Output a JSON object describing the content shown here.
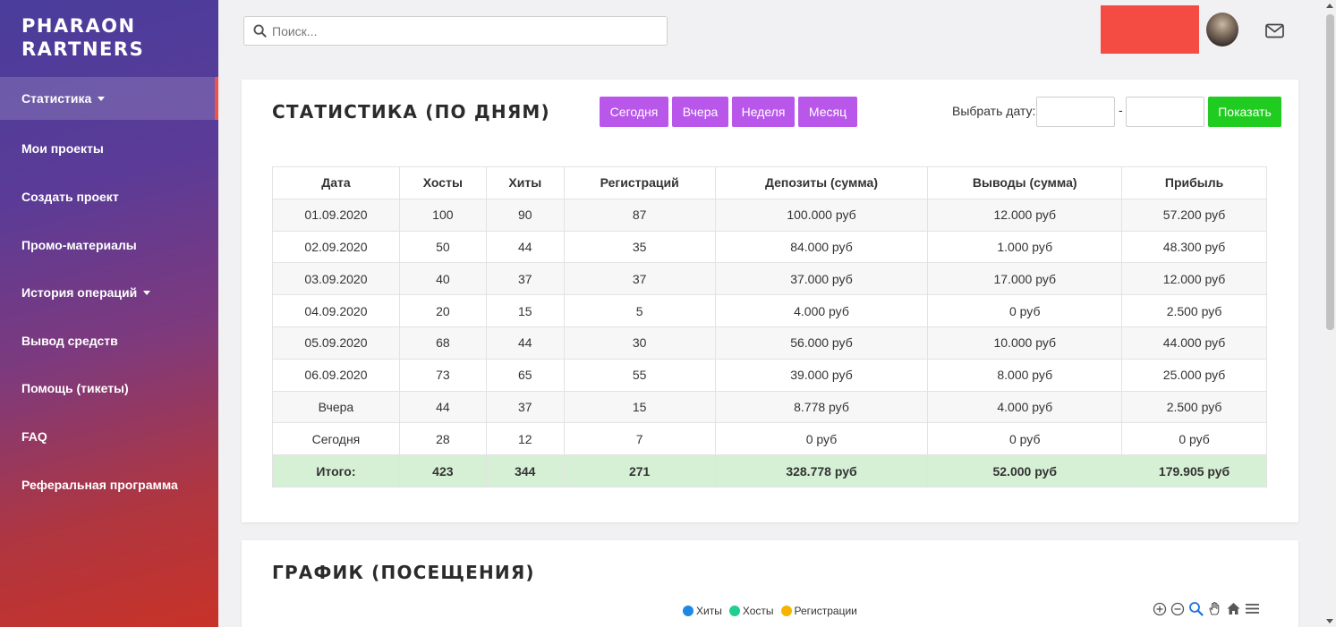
{
  "brand": {
    "line1": "PHARAON",
    "line2": "RARTNERS"
  },
  "sidebar": {
    "items": [
      {
        "label": "Статистика",
        "dropdown": true,
        "active": true
      },
      {
        "label": "Мои проекты"
      },
      {
        "label": "Создать проект"
      },
      {
        "label": "Промо-материалы"
      },
      {
        "label": "История операций",
        "dropdown": true
      },
      {
        "label": "Вывод средств"
      },
      {
        "label": "Помощь (тикеты)"
      },
      {
        "label": "FAQ"
      },
      {
        "label": "Реферальная программа"
      }
    ]
  },
  "search": {
    "placeholder": "Поиск..."
  },
  "stats": {
    "title": "СТАТИСТИКА (ПО ДНЯМ)",
    "periods": [
      "Сегодня",
      "Вчера",
      "Неделя",
      "Месяц"
    ],
    "date_label": "Выбрать дату:",
    "date_separator": "-",
    "show_label": "Показать",
    "columns": [
      "Дата",
      "Хосты",
      "Хиты",
      "Регистраций",
      "Депозиты (сумма)",
      "Выводы (сумма)",
      "Прибыль"
    ],
    "rows": [
      [
        "01.09.2020",
        "100",
        "90",
        "87",
        "100.000 руб",
        "12.000 руб",
        "57.200 руб"
      ],
      [
        "02.09.2020",
        "50",
        "44",
        "35",
        "84.000 руб",
        "1.000 руб",
        "48.300 руб"
      ],
      [
        "03.09.2020",
        "40",
        "37",
        "37",
        "37.000 руб",
        "17.000 руб",
        "12.000 руб"
      ],
      [
        "04.09.2020",
        "20",
        "15",
        "5",
        "4.000 руб",
        "0 руб",
        "2.500 руб"
      ],
      [
        "05.09.2020",
        "68",
        "44",
        "30",
        "56.000 руб",
        "10.000 руб",
        "44.000 руб"
      ],
      [
        "06.09.2020",
        "73",
        "65",
        "55",
        "39.000 руб",
        "8.000 руб",
        "25.000 руб"
      ],
      [
        "Вчера",
        "44",
        "37",
        "15",
        "8.778 руб",
        "4.000 руб",
        "2.500 руб"
      ],
      [
        "Сегодня",
        "28",
        "12",
        "7",
        "0 руб",
        "0 руб",
        "0 руб"
      ]
    ],
    "total": [
      "Итого:",
      "423",
      "344",
      "271",
      "328.778 руб",
      "52.000 руб",
      "179.905 руб"
    ]
  },
  "chart": {
    "title": "ГРАФИК (ПОСЕЩЕНИЯ)",
    "legend": [
      {
        "name": "Хиты",
        "color": "#1e88e5"
      },
      {
        "name": "Хосты",
        "color": "#1ecf8f"
      },
      {
        "name": "Регистрации",
        "color": "#f4b400"
      }
    ],
    "tools": [
      "zoom-in-icon",
      "zoom-out-icon",
      "selection-zoom-icon",
      "pan-icon",
      "home-icon",
      "menu-icon"
    ]
  },
  "colors": {
    "period_button": "#b857ea",
    "show_button": "#1fcc1f",
    "total_row": "#d6f0d6",
    "red_block": "#f44c42"
  }
}
